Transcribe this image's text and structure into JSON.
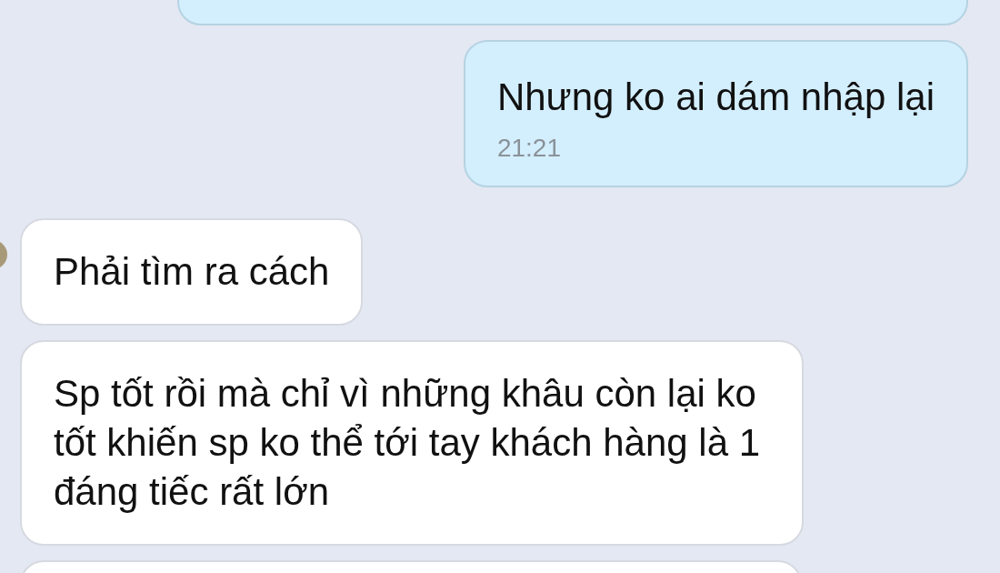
{
  "messages": [
    {
      "kind": "outgoing",
      "partial": true
    },
    {
      "kind": "outgoing",
      "text": "Nhưng ko ai dám nhập lại",
      "time": "21:21"
    },
    {
      "kind": "incoming",
      "text": "Phải tìm ra cách",
      "has_avatar": true
    },
    {
      "kind": "incoming",
      "text": "Sp tốt rồi mà chỉ vì những khâu còn lại ko tốt khiến sp ko thể tới tay khách hàng là 1 đáng tiếc rất lớn"
    },
    {
      "kind": "incoming",
      "partial": true
    }
  ]
}
